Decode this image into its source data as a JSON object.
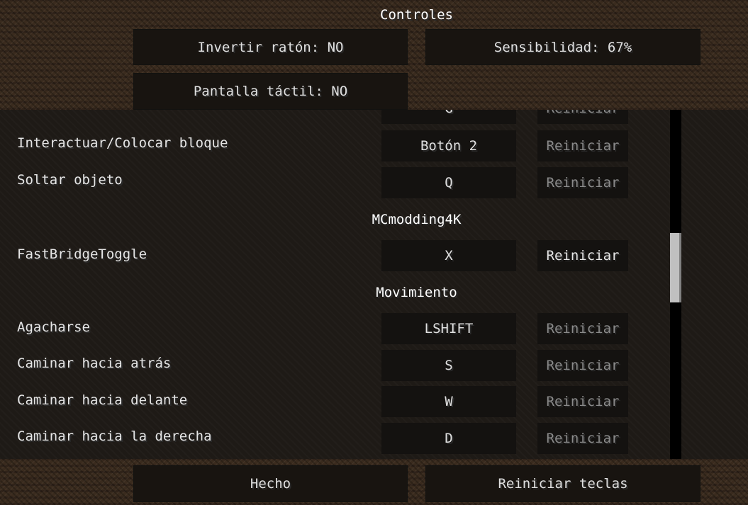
{
  "title": "Controles",
  "options": {
    "invert_mouse": "Invertir ratón: NO",
    "sensitivity": "Sensibilidad: 67%",
    "touchscreen": "Pantalla táctil: NO"
  },
  "list": {
    "clipped_top": {
      "key": "G",
      "reset": "Reiniciar"
    },
    "rows_top": [
      {
        "label": "Interactuar/Colocar bloque",
        "key": "Botón 2",
        "reset": "Reiniciar",
        "reset_active": false
      },
      {
        "label": "Soltar objeto",
        "key": "Q",
        "reset": "Reiniciar",
        "reset_active": false
      }
    ],
    "section_mod": "MCmodding4K",
    "rows_mod": [
      {
        "label": "FastBridgeToggle",
        "key": "X",
        "reset": "Reiniciar",
        "reset_active": true
      }
    ],
    "section_move": "Movimiento",
    "rows_move": [
      {
        "label": "Agacharse",
        "key": "LSHIFT",
        "reset": "Reiniciar",
        "reset_active": false
      },
      {
        "label": "Caminar hacia atrás",
        "key": "S",
        "reset": "Reiniciar",
        "reset_active": false
      },
      {
        "label": "Caminar hacia delante",
        "key": "W",
        "reset": "Reiniciar",
        "reset_active": false
      },
      {
        "label": "Caminar hacia la derecha",
        "key": "D",
        "reset": "Reiniciar",
        "reset_active": false
      }
    ],
    "scroll_position": 0.42
  },
  "footer": {
    "done": "Hecho",
    "reset_keys": "Reiniciar teclas"
  },
  "colors": {
    "text": "#e0e0e0",
    "disabled_text": "#8a8a8a",
    "button_bg": "#181410",
    "dirt_bg": "#3a2b1e"
  }
}
